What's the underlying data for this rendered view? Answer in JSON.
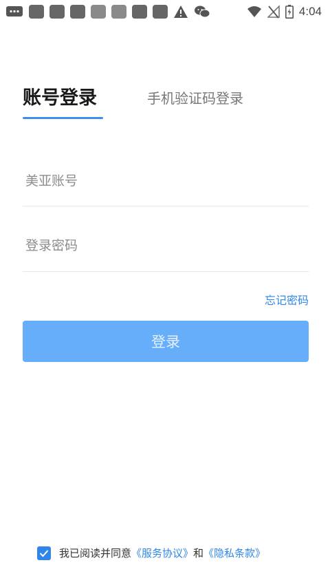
{
  "status_bar": {
    "time": "4:04",
    "icons": [
      "message-icon",
      "notification-icon",
      "notification-icon",
      "notification-icon",
      "notification-icon",
      "notification-icon",
      "notification-icon",
      "notification-icon",
      "warning-icon",
      "wechat-icon",
      "wifi-icon",
      "no-signal-icon",
      "battery-charging-icon"
    ]
  },
  "tabs": {
    "account": "账号登录",
    "phone": "手机验证码登录"
  },
  "form": {
    "account_placeholder": "美亚账号",
    "password_placeholder": "登录密码",
    "forgot_label": "忘记密码",
    "login_label": "登录"
  },
  "agreement": {
    "prefix": "我已阅读并同意",
    "service_link": "《服务协议》",
    "conjunction": "和",
    "privacy_link": "《隐私条款》",
    "checked": true
  },
  "colors": {
    "accent": "#2f86e8",
    "button": "#66aefa"
  }
}
